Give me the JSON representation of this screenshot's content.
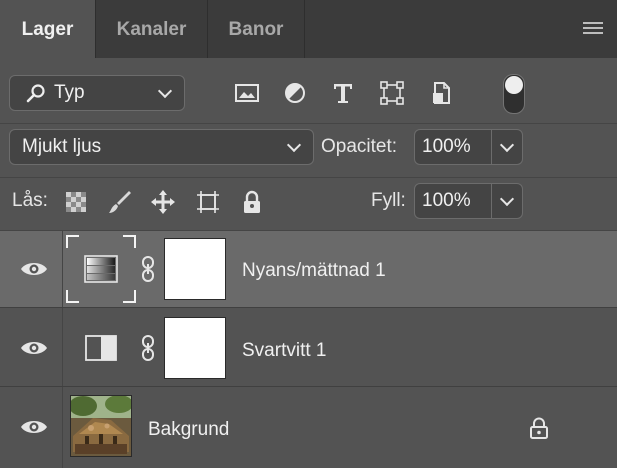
{
  "tabs": [
    {
      "label": "Lager",
      "active": true
    },
    {
      "label": "Kanaler",
      "active": false
    },
    {
      "label": "Banor",
      "active": false
    }
  ],
  "filter": {
    "label": "Typ"
  },
  "blend": {
    "mode": "Mjukt ljus",
    "opacity_label": "Opacitet:",
    "opacity_value": "100%"
  },
  "lock": {
    "label": "Lås:",
    "fill_label": "Fyll:",
    "fill_value": "100%"
  },
  "layers": [
    {
      "name": "Nyans/mättnad 1",
      "type": "hue-saturation",
      "selected": true,
      "visible": true
    },
    {
      "name": "Svartvitt 1",
      "type": "black-white",
      "selected": false,
      "visible": true
    },
    {
      "name": "Bakgrund",
      "type": "image",
      "selected": false,
      "visible": true,
      "locked": true
    }
  ],
  "colors": {
    "panel": "#535353",
    "tabbar": "#3b3b3b",
    "selected_row": "#6a6a6a"
  }
}
